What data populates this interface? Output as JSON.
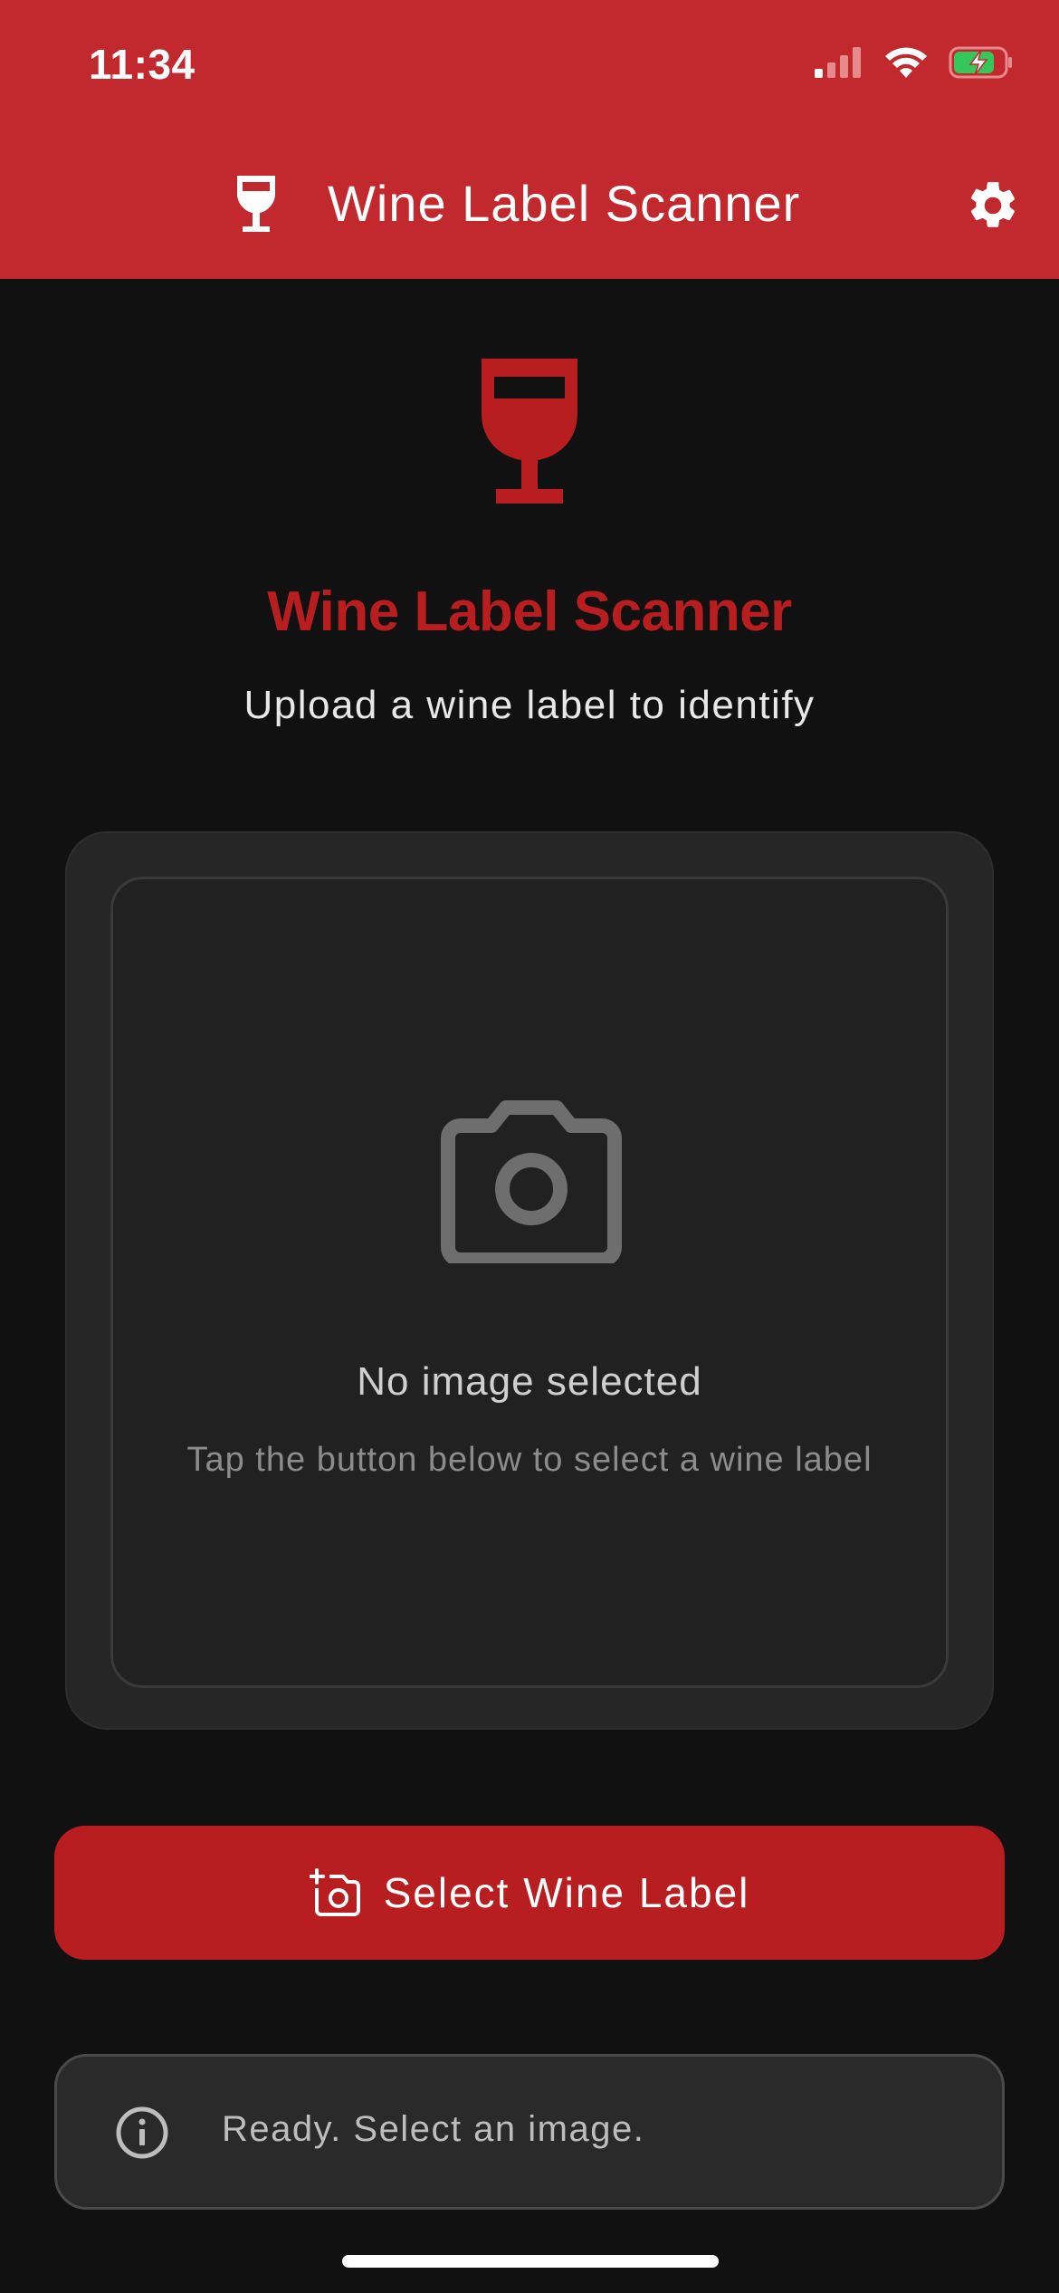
{
  "status_bar": {
    "time": "11:34"
  },
  "app_bar": {
    "title": "Wine Label Scanner",
    "leading_icon": "wine-glass-icon",
    "settings_icon": "gear-icon",
    "background_color": "#C1292E"
  },
  "hero": {
    "icon": "wine-glass-icon",
    "title": "Wine Label Scanner",
    "subtitle": "Upload a wine label to identify",
    "accent_color": "#B81D20"
  },
  "image_picker": {
    "icon": "camera-icon",
    "empty_title": "No image selected",
    "empty_hint": "Tap the button below to select a wine label"
  },
  "actions": {
    "select_label": "Select Wine Label",
    "select_icon": "add-photo-icon"
  },
  "status": {
    "icon": "info-icon",
    "message": "Ready. Select an image."
  }
}
